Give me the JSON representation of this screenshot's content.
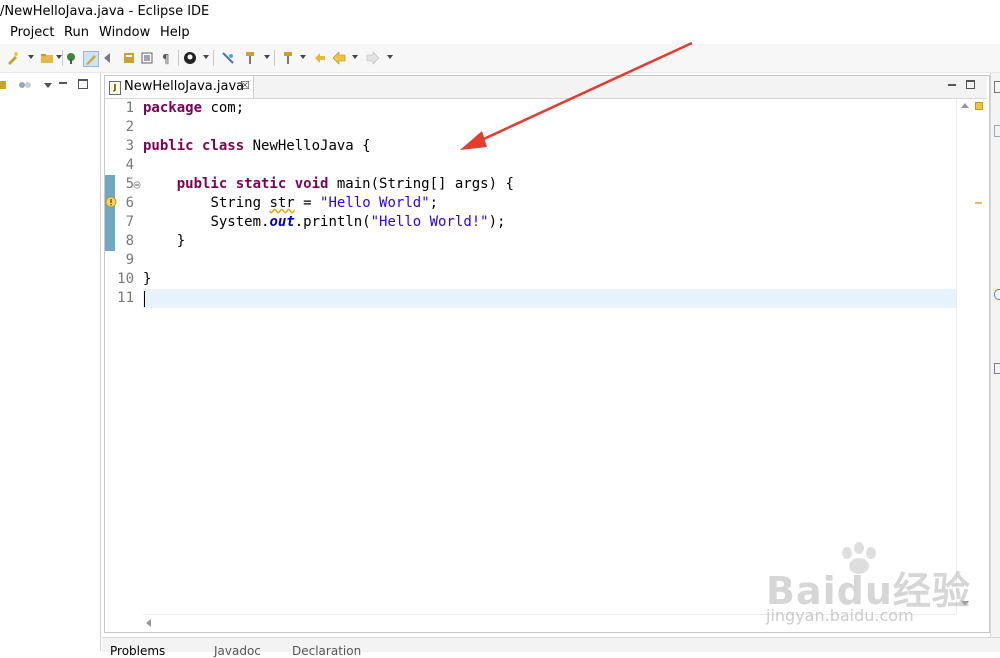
{
  "window": {
    "title": "/NewHelloJava.java - Eclipse IDE"
  },
  "menu": {
    "items": [
      "Project",
      "Run",
      "Window",
      "Help"
    ]
  },
  "editor": {
    "tab_label": "NewHelloJava.java",
    "tab_close": "☒",
    "line_numbers": [
      "1",
      "2",
      "3",
      "4",
      "5",
      "6",
      "7",
      "8",
      "9",
      "10",
      "11"
    ],
    "code": {
      "l1_kw": "package",
      "l1_rest": " com;",
      "l3_kw": "public class",
      "l3_rest": " NewHelloJava {",
      "l5_indent": "    ",
      "l5_kw": "public static void",
      "l5_rest": " main(String[] args) {",
      "l6_indent": "        ",
      "l6_type": "String ",
      "l6_var": "str",
      "l6_eq": " = ",
      "l6_str": "\"Hello World\"",
      "l6_end": ";",
      "l7_indent": "        ",
      "l7_obj": "System.",
      "l7_field": "out",
      "l7_call": ".println(",
      "l7_str": "\"Hello World!\"",
      "l7_end": ");",
      "l8": "    }",
      "l10": "}"
    },
    "current_line": 11
  },
  "bottom_tabs": [
    "Problems",
    "Javadoc",
    "Declaration"
  ],
  "watermark": {
    "text": "Baidu经验",
    "sub": "jingyan.baidu.com"
  },
  "colors": {
    "keyword": "#7f0055",
    "string": "#2a00ff",
    "field": "#0000c0",
    "arrow": "#e33b2e",
    "current_line": "#e8f2fe"
  }
}
